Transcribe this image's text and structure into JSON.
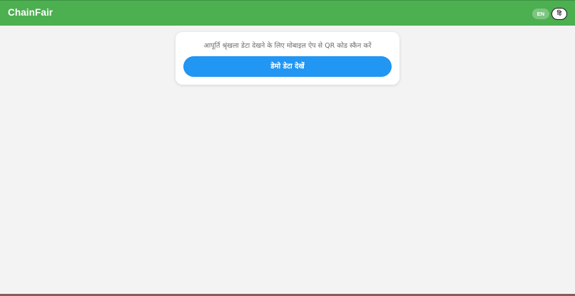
{
  "header": {
    "brand": "ChainFair",
    "lang_en": "EN",
    "lang_hi": "हि"
  },
  "card": {
    "instruction": "आपूर्ति श्रृंखला डेटा देखने के लिए मोबाइल ऐप से QR कोड स्कैन करें",
    "demo_button": "डेमो डेटा देखें"
  },
  "colors": {
    "header_bg": "#4caf50",
    "button_bg": "#2196f3",
    "page_bg": "#f3f3f3"
  }
}
